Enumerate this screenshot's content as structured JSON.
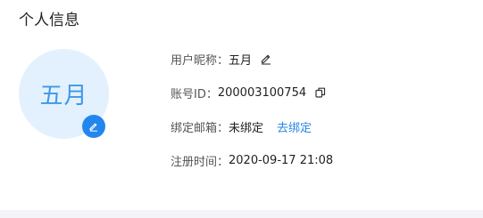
{
  "section": {
    "title": "个人信息"
  },
  "avatar": {
    "text": "五月"
  },
  "profile": {
    "nickname": {
      "label": "用户昵称：",
      "value": "五月"
    },
    "account_id": {
      "label": "账号ID：",
      "value": "200003100754"
    },
    "email": {
      "label": "绑定邮箱：",
      "value": "未绑定",
      "action_label": "去绑定"
    },
    "register_time": {
      "label": "注册时间：",
      "value": "2020-09-17 21:08"
    }
  },
  "icons": {
    "nickname_edit": "pencil-icon",
    "account_copy": "copy-icon",
    "avatar_edit": "pencil-icon"
  },
  "colors": {
    "accent": "#2386ee",
    "avatar_bg": "#e2f1fd",
    "avatar_text": "#3f97e8",
    "link": "#2a86e6"
  }
}
